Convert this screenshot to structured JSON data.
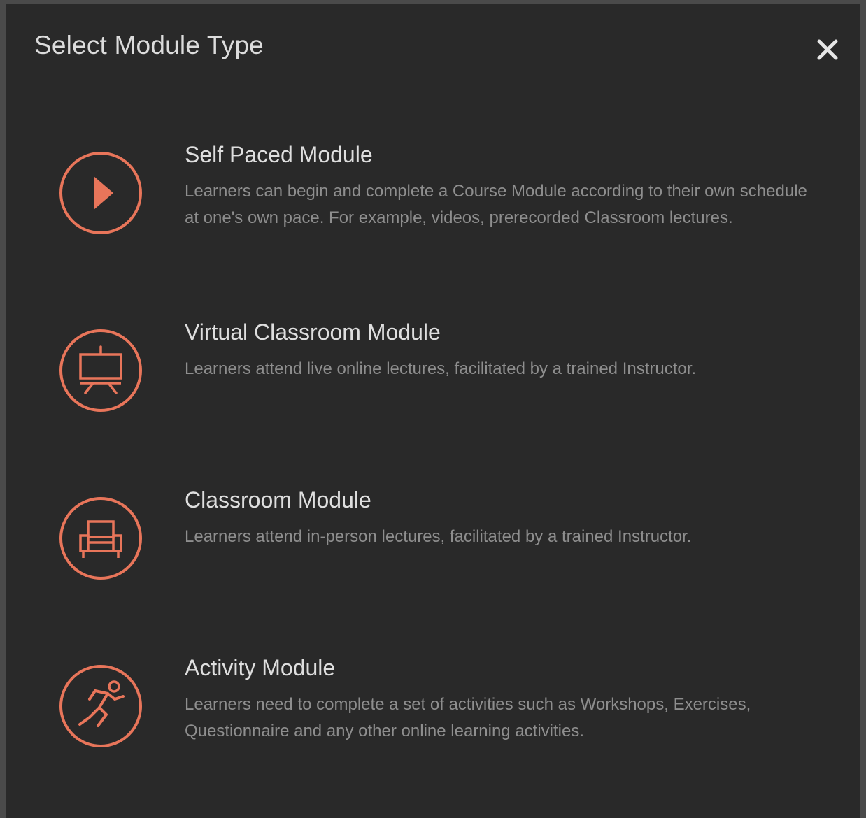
{
  "modal": {
    "title": "Select Module Type",
    "close_icon": "close-icon"
  },
  "colors": {
    "accent": "#e8755a",
    "background": "#292929",
    "title_text": "#dedede",
    "desc_text": "#8e8e8e"
  },
  "options": [
    {
      "icon": "play-icon",
      "title": "Self Paced Module",
      "description": "Learners can begin and complete a Course Module according to their own schedule at one's own pace. For example, videos, prerecorded Classroom lectures."
    },
    {
      "icon": "presentation-board-icon",
      "title": "Virtual Classroom Module",
      "description": "Learners attend live online lectures, facilitated by a trained Instructor."
    },
    {
      "icon": "chair-icon",
      "title": "Classroom Module",
      "description": "Learners attend in-person lectures, facilitated by a trained Instructor."
    },
    {
      "icon": "running-person-icon",
      "title": "Activity Module",
      "description": "Learners need to complete a set of activities such as Workshops, Exercises, Questionnaire and any other online learning activities."
    }
  ]
}
